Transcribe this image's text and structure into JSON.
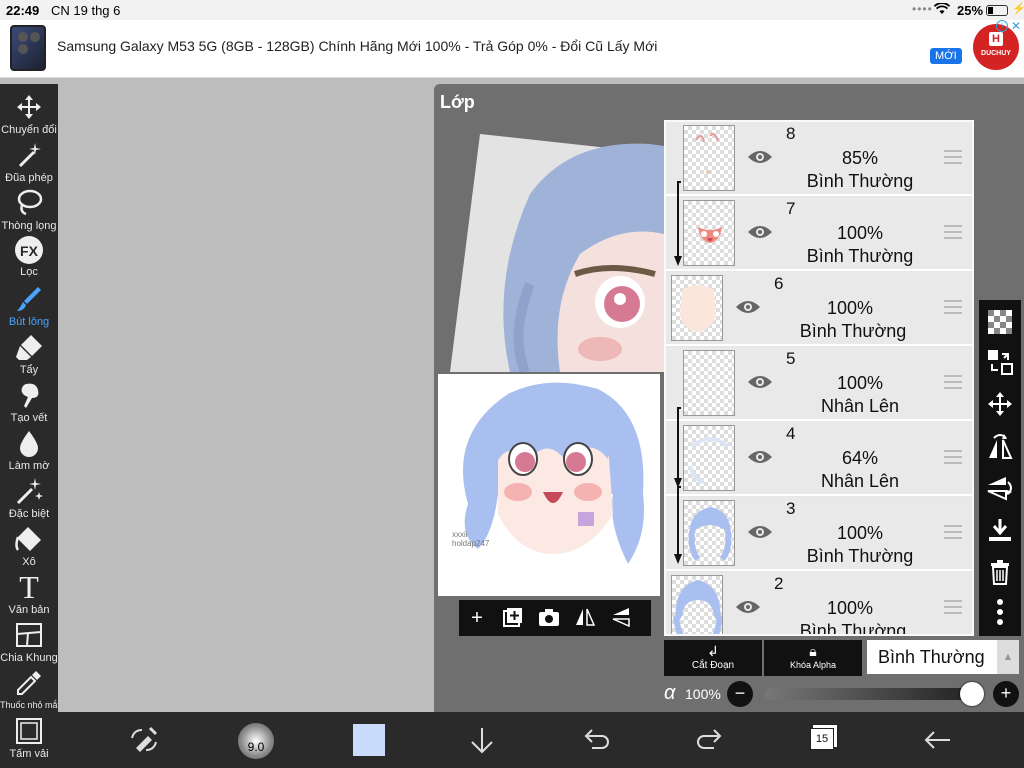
{
  "status": {
    "time": "22:49",
    "date": "CN 19 thg 6",
    "dots": "••••",
    "battery": "25%"
  },
  "ad": {
    "text": "Samsung Galaxy M53 5G (8GB - 128GB) Chính Hãng Mới 100% - Trả Góp 0% - Đổi Cũ Lấy Mới",
    "new_label": "MỚI",
    "brand": "DUCHUY",
    "info": "i",
    "close": "✕"
  },
  "tools": [
    {
      "label": "Chuyển đổi",
      "icon": "move-icon",
      "active": false
    },
    {
      "label": "Đũa phép",
      "icon": "magic-wand-icon",
      "active": false
    },
    {
      "label": "Thòng lọng",
      "icon": "lasso-icon",
      "active": false
    },
    {
      "label": "Lọc",
      "icon": "fx-icon",
      "active": false,
      "badge": "FX"
    },
    {
      "label": "Bút lông",
      "icon": "brush-icon",
      "active": true
    },
    {
      "label": "Tẩy",
      "icon": "eraser-icon",
      "active": false
    },
    {
      "label": "Tạo vết",
      "icon": "smudge-icon",
      "active": false
    },
    {
      "label": "Làm mờ",
      "icon": "blur-icon",
      "active": false
    },
    {
      "label": "Đặc biệt",
      "icon": "special-icon",
      "active": false
    },
    {
      "label": "Xô",
      "icon": "bucket-icon",
      "active": false
    },
    {
      "label": "Văn bản",
      "icon": "text-icon",
      "active": false,
      "badge": "T"
    },
    {
      "label": "Chia Khung",
      "icon": "frame-divider-icon",
      "active": false
    },
    {
      "label": "Thuốc nhỏ mắt",
      "icon": "eyedropper-icon",
      "active": false
    },
    {
      "label": "Tấm vải",
      "icon": "canvas-icon",
      "active": false
    }
  ],
  "panel": {
    "title": "Lớp",
    "signature": "xxxii\nholdap247"
  },
  "layers": [
    {
      "number": "8",
      "opacity": "85%",
      "mode": "Bình Thường",
      "clipped": true
    },
    {
      "number": "7",
      "opacity": "100%",
      "mode": "Bình Thường",
      "clipped": true
    },
    {
      "number": "6",
      "opacity": "100%",
      "mode": "Bình Thường",
      "clipped": false
    },
    {
      "number": "5",
      "opacity": "100%",
      "mode": "Nhân Lên",
      "clipped": false
    },
    {
      "number": "4",
      "opacity": "64%",
      "mode": "Nhân Lên",
      "clipped": true
    },
    {
      "number": "3",
      "opacity": "100%",
      "mode": "Bình Thường",
      "clipped": true
    },
    {
      "number": "2",
      "opacity": "100%",
      "mode": "Bình Thường",
      "clipped": false
    }
  ],
  "layer_controls": {
    "clip_label": "Cắt Đoạn",
    "alpha_lock_label": "Khóa Alpha",
    "blend_mode": "Bình Thường",
    "alpha_symbol": "α",
    "alpha_value": "100%",
    "alpha_level": 1.0
  },
  "bottom": {
    "brush_size": "9.0",
    "layer_count": "15",
    "color": "#c9dcfb"
  }
}
